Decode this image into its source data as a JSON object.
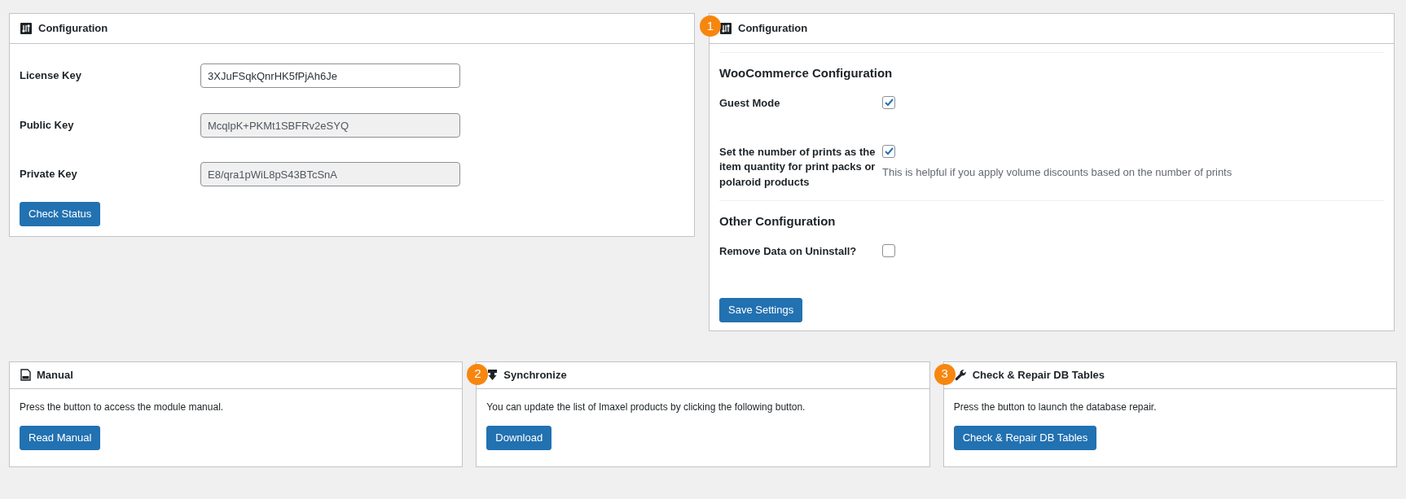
{
  "license_panel": {
    "title": "Configuration",
    "fields": [
      {
        "label": "License Key",
        "value": "3XJuFSqkQnrHK5fPjAh6Je",
        "disabled": false
      },
      {
        "label": "Public Key",
        "value": "McqlpK+PKMt1SBFRv2eSYQ",
        "disabled": true
      },
      {
        "label": "Private Key",
        "value": "E8/qra1pWiL8pS43BTcSnA",
        "disabled": true
      }
    ],
    "button": "Check Status"
  },
  "settings_panel": {
    "title": "Configuration",
    "marker": "1",
    "sections": [
      {
        "heading": "WooCommerce Configuration",
        "options": [
          {
            "label": "Guest Mode",
            "checked": true
          },
          {
            "label": "Set the number of prints as the item quantity for print packs or polaroid products",
            "checked": true,
            "hint": "This is helpful if you apply volume discounts based on the number of prints"
          }
        ]
      },
      {
        "heading": "Other Configuration",
        "options": [
          {
            "label": "Remove Data on Uninstall?",
            "checked": false
          }
        ]
      }
    ],
    "button": "Save Settings"
  },
  "bottom_panels": [
    {
      "kind": "manual",
      "title": "Manual",
      "text": "Press the button to access the module manual.",
      "button": "Read Manual"
    },
    {
      "kind": "sync",
      "title": "Synchronize",
      "marker": "2",
      "text": "You can update the list of Imaxel products by clicking the following button.",
      "button": "Download"
    },
    {
      "kind": "repair",
      "title": "Check & Repair DB Tables",
      "marker": "3",
      "text": "Press the button to launch the database repair.",
      "button": "Check & Repair DB Tables"
    }
  ]
}
